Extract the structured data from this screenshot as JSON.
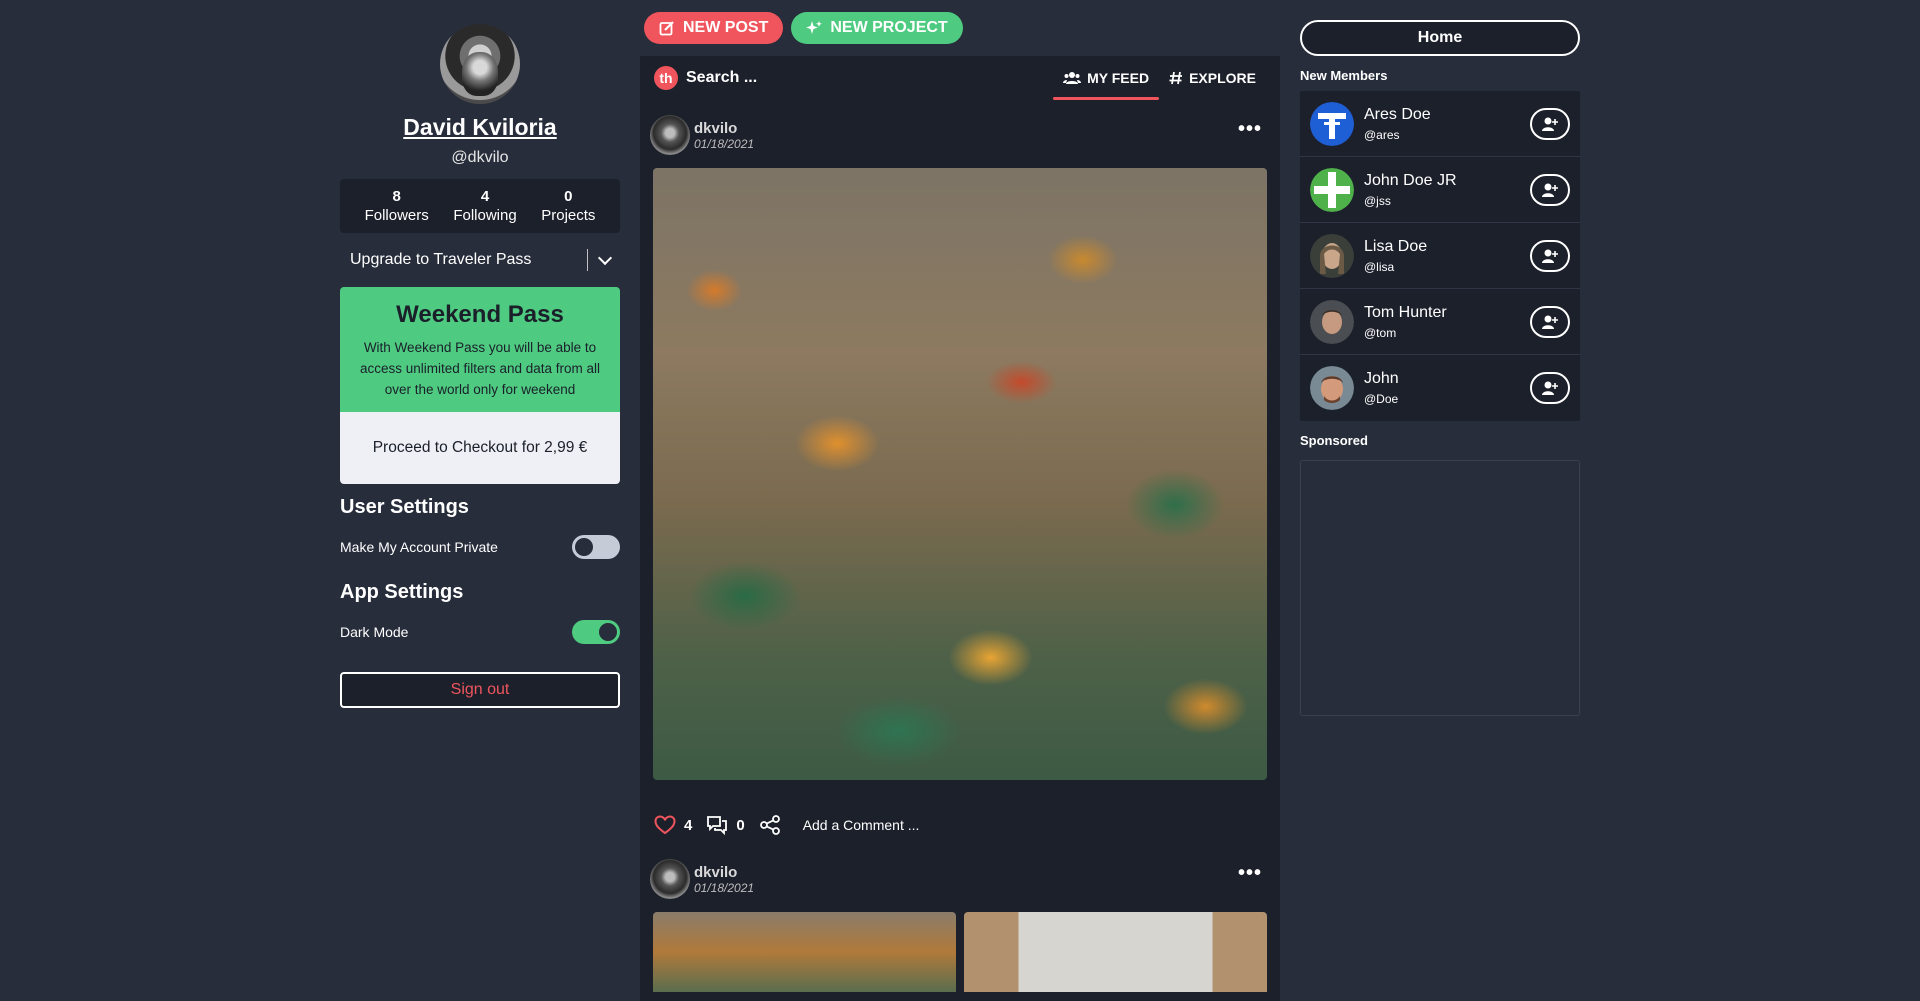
{
  "profile": {
    "name": "David Kviloria",
    "handle": "@dkvilo",
    "stats": [
      {
        "num": "8",
        "label": "Followers"
      },
      {
        "num": "4",
        "label": "Following"
      },
      {
        "num": "0",
        "label": "Projects"
      }
    ],
    "upgrade_label": "Upgrade to Traveler Pass"
  },
  "pass": {
    "title": "Weekend Pass",
    "description": "With Weekend Pass you will be able to access unlimited filters and data from all over the world only for weekend",
    "checkout_label": "Proceed to Checkout for 2,99 €"
  },
  "settings": {
    "user_title": "User Settings",
    "private_label": "Make My Account Private",
    "private_on": false,
    "app_title": "App Settings",
    "dark_label": "Dark Mode",
    "dark_on": true,
    "signout_label": "Sign out"
  },
  "toolbar": {
    "new_post": "NEW POST",
    "new_project": "NEW PROJECT"
  },
  "feed": {
    "logo": "th",
    "search_placeholder": "Search ...",
    "tabs": [
      {
        "label": "MY FEED",
        "icon": "users-icon",
        "active": true
      },
      {
        "label": "EXPLORE",
        "icon": "hashtag-icon",
        "active": false
      }
    ],
    "posts": [
      {
        "user": "dkvilo",
        "date": "01/18/2021",
        "likes": "4",
        "comments": "0",
        "comment_placeholder": "Add a Comment ..."
      },
      {
        "user": "dkvilo",
        "date": "01/18/2021"
      }
    ]
  },
  "right": {
    "home_label": "Home",
    "new_members_title": "New Members",
    "members": [
      {
        "name": "Ares Doe",
        "handle": "@ares"
      },
      {
        "name": "John Doe JR",
        "handle": "@jss"
      },
      {
        "name": "Lisa Doe",
        "handle": "@lisa"
      },
      {
        "name": "Tom Hunter",
        "handle": "@tom"
      },
      {
        "name": "John",
        "handle": "@Doe"
      }
    ],
    "sponsored_title": "Sponsored"
  },
  "colors": {
    "background": "#272d3b",
    "panel": "#1c202b",
    "accent_red": "#f0555d",
    "accent_green": "#4ecb80"
  }
}
